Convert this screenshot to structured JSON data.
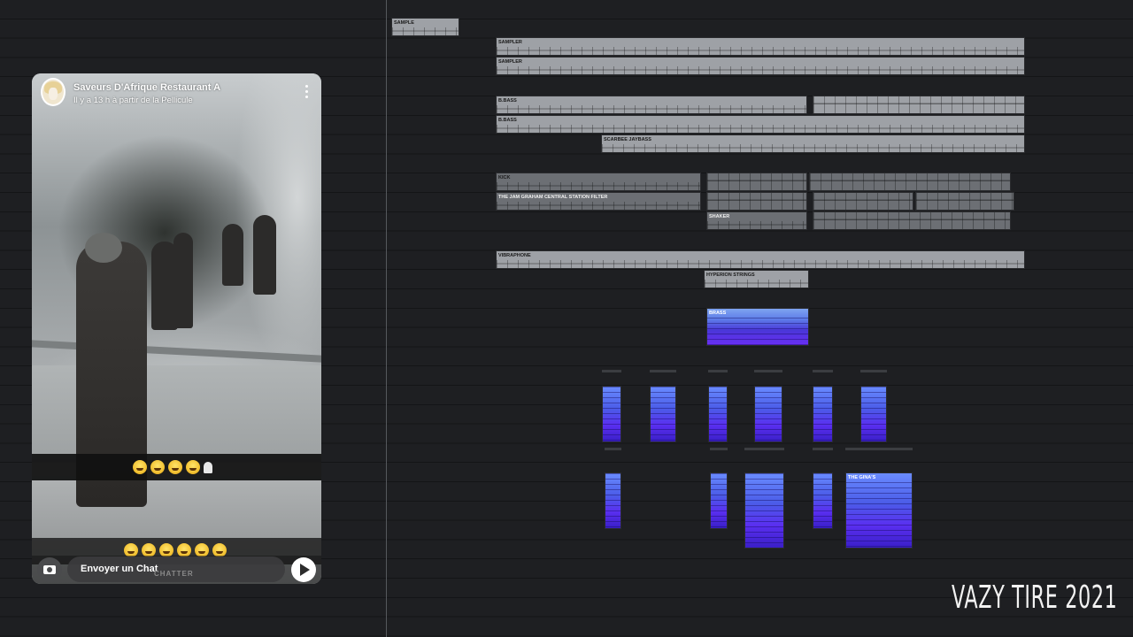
{
  "playlist": {
    "clips": {
      "sample": "SAMPLE",
      "sampler_1": "SAMPLER",
      "sampler_2": "SAMPLER",
      "bbass_1": "B.BASS",
      "bbass_2": "B.BASS",
      "scarbee": "SCARBEE JAYBASS",
      "kick": "KICK",
      "filter": "THE JAM GRAHAM CENTRAL STATION FILTER",
      "shaker": "SHAKER",
      "vibraphone": "VIBRAPHONE",
      "strings": "HYPERION STRINGS",
      "brass": "BRASS",
      "ginas": "THE GINA'S"
    },
    "colors": {
      "clip_grey": "#9ea1a6",
      "clip_blue": "#5a4cf0",
      "background": "#1b1c1e"
    }
  },
  "snapchat": {
    "account_name": "Saveurs D'Afrique Restaurant A",
    "subtitle": "Il y a 13 h à partir de la Pellicule",
    "menu_icon": "kebab-menu-icon",
    "camera_icon": "camera-icon",
    "send_icon": "send-arrow-icon",
    "chat_placeholder": "Envoyer un Chat",
    "faded_label": "CHATTER",
    "emoji_row_1": [
      "laughing-emoji",
      "laughing-emoji",
      "laughing-emoji",
      "laughing-emoji",
      "ghost-emoji"
    ],
    "emoji_row_2": [
      "laughing-emoji",
      "laughing-emoji",
      "laughing-emoji",
      "laughing-emoji",
      "laughing-emoji",
      "laughing-emoji"
    ]
  },
  "watermark": "VAZY TIRE 2021"
}
